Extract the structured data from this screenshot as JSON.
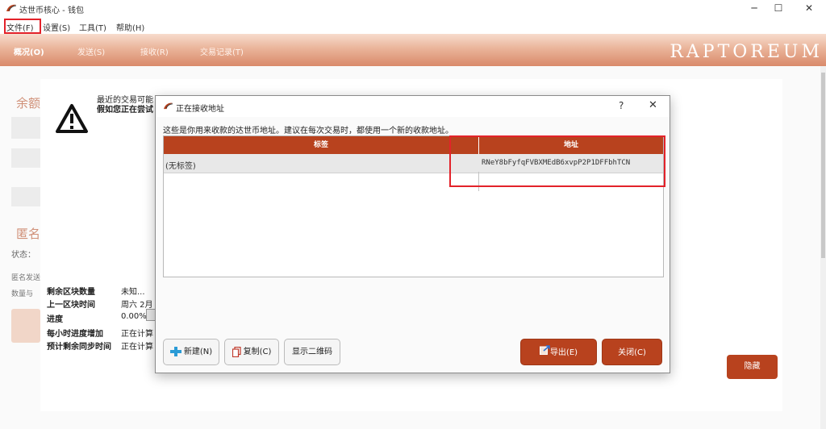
{
  "window": {
    "title": "达世币核心 - 钱包",
    "controls": {
      "minimize": "─",
      "maximize": "☐",
      "close": "✕"
    }
  },
  "menu": {
    "items": [
      "文件(F)",
      "设置(S)",
      "工具(T)",
      "帮助(H)"
    ]
  },
  "nav": {
    "tabs": [
      "概况(O)",
      "发送(S)",
      "接收(R)",
      "交易记录(T)"
    ],
    "brand": "RAPTOREUM"
  },
  "overview": {
    "balance_label": "余额",
    "anon_label": "匿名",
    "status_label": "状态：",
    "anon_sent": "匿名发送",
    "anon_count": "数量与"
  },
  "sync": {
    "message_line1": "最近的交易可能",
    "message_line2": "假如您正在尝试",
    "rows": [
      {
        "label": "剩余区块数量",
        "value": "未知..."
      },
      {
        "label": "上一区块时间",
        "value": "周六 2月"
      },
      {
        "label": "进度",
        "value": "0.00%"
      },
      {
        "label": "每小时进度增加",
        "value": "正在计算"
      },
      {
        "label": "预计剩余同步时间",
        "value": "正在计算"
      }
    ],
    "hide_button": "隐藏"
  },
  "dialog": {
    "title": "正在接收地址",
    "help": "?",
    "close": "✕",
    "description": "这些是你用来收款的达世币地址。建议在每次交易时，都使用一个新的收款地址。",
    "columns": {
      "label": "标签",
      "address": "地址"
    },
    "rows": [
      {
        "label": "(无标签)",
        "address": "RNeY8bFyfqFVBXMEdB6xvpP2P1DFFbhTCN"
      }
    ],
    "buttons": {
      "new": "新建(N)",
      "copy": "复制(C)",
      "show_qr": "显示二维码",
      "export": "导出(E)",
      "close": "关闭(C)"
    }
  },
  "colors": {
    "accent": "#b8421e",
    "highlight": "#e3222a",
    "nav_gradient_top": "#f7dccd",
    "nav_gradient_bottom": "#d98a6a"
  }
}
